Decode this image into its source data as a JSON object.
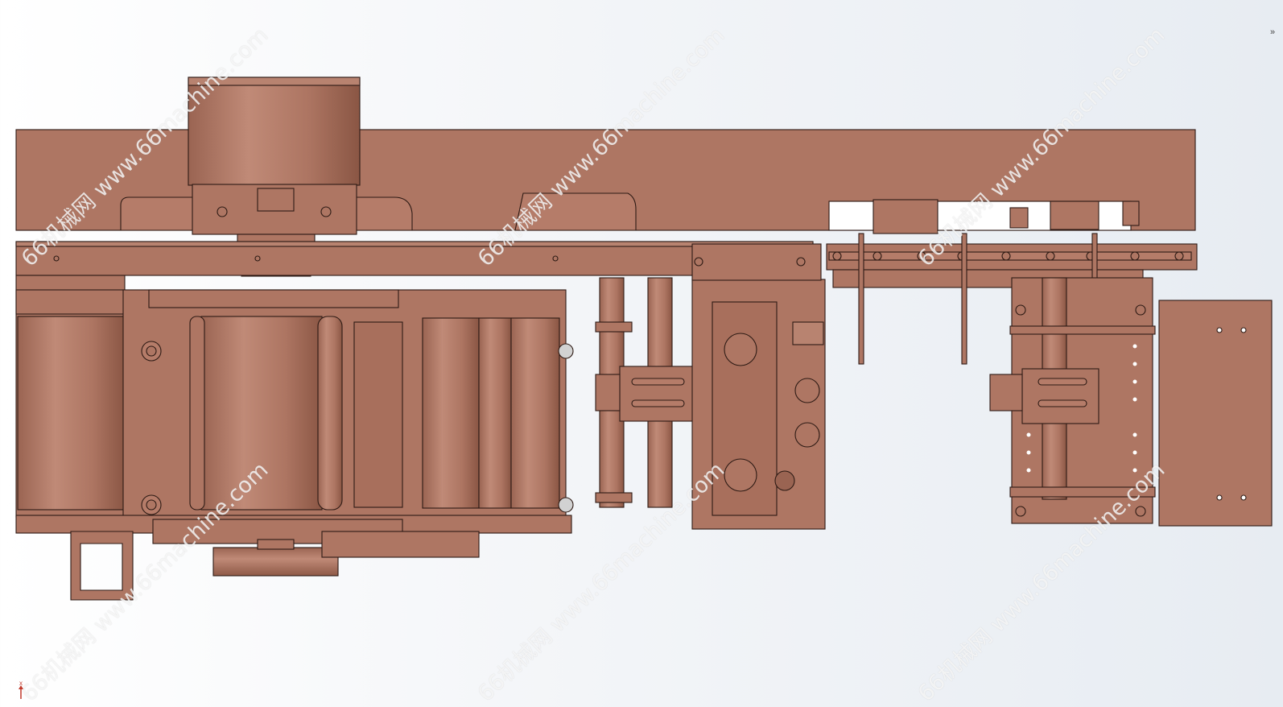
{
  "watermark": {
    "text": "66机械网 www.66machine.com"
  },
  "triad": {
    "x_axis_label": "x"
  },
  "toolbar": {
    "expand_icon": "chevron-right-icon"
  },
  "colors": {
    "part_fill": "#ae7663",
    "part_highlight": "#bf8875",
    "part_shadow": "#8e5a49",
    "edge": "#2d1a14",
    "background": "#f2f4f7"
  }
}
